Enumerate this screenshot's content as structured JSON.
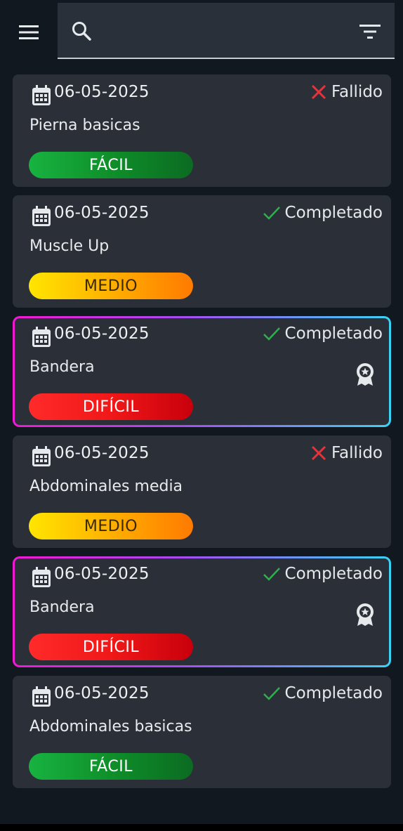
{
  "search": {
    "value": "",
    "placeholder": ""
  },
  "status_colors": {
    "success": "#2bb24c",
    "failure": "#e5323b"
  },
  "cards": [
    {
      "date": "06-05-2025",
      "status": "Fallido",
      "status_icon": "close-icon",
      "title": "Pierna basicas",
      "difficulty": "FÁCIL",
      "featured": false
    },
    {
      "date": "06-05-2025",
      "status": "Completado",
      "status_icon": "check-icon",
      "title": "Muscle Up",
      "difficulty": "MEDIO",
      "featured": false
    },
    {
      "date": "06-05-2025",
      "status": "Completado",
      "status_icon": "check-icon",
      "title": "Bandera",
      "difficulty": "DIFÍCIL",
      "featured": true
    },
    {
      "date": "06-05-2025",
      "status": "Fallido",
      "status_icon": "close-icon",
      "title": "Abdominales media",
      "difficulty": "MEDIO",
      "featured": false
    },
    {
      "date": "06-05-2025",
      "status": "Completado",
      "status_icon": "check-icon",
      "title": "Bandera",
      "difficulty": "DIFÍCIL",
      "featured": true
    },
    {
      "date": "06-05-2025",
      "status": "Completado",
      "status_icon": "check-icon",
      "title": "Abdominales basicas",
      "difficulty": "FÁCIL",
      "featured": false
    }
  ]
}
